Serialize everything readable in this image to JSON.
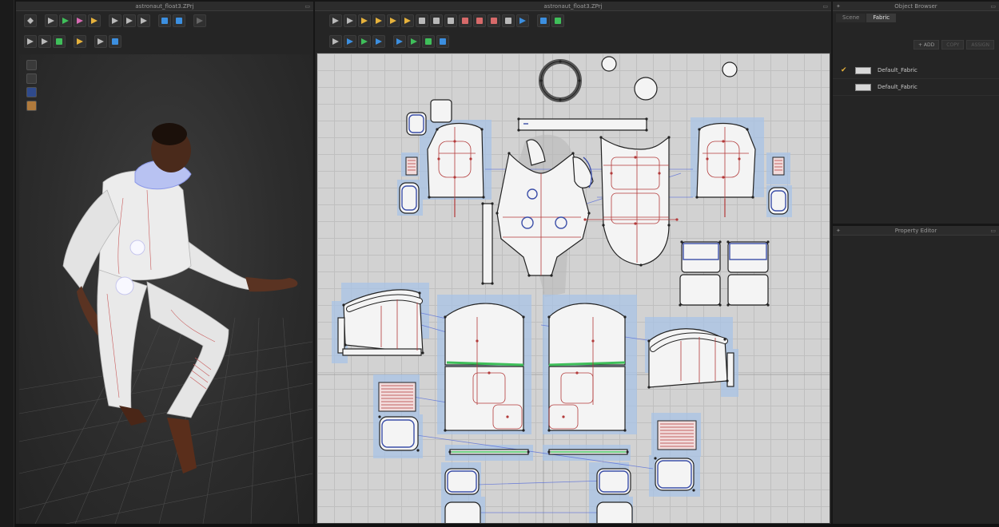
{
  "left_strip": {
    "label": ""
  },
  "viewport3d": {
    "title": "astronaut_float3.ZPrj"
  },
  "pattern2d": {
    "title": "astronaut_float3.ZPrj"
  },
  "object_browser": {
    "title": "Object Browser",
    "tabs": [
      "Scene",
      "Fabric"
    ],
    "active_tab": "Fabric",
    "actions": {
      "add": "+ ADD",
      "copy": "COPY",
      "assign": "ASSIGN"
    },
    "fabrics": [
      {
        "name": "Default_Fabric",
        "selected": true
      },
      {
        "name": "Default_Fabric",
        "selected": false
      }
    ]
  },
  "property_editor": {
    "title": "Property Editor"
  },
  "icons": {
    "dock": "dock-icon",
    "pin": "pin-icon",
    "check": "checkmark-icon"
  },
  "colors": {
    "seam_red": "#b23a3a",
    "seam_blue": "#5a6fd8",
    "seam_green": "#3fbf5a",
    "selection_blue": "#a9c4e6",
    "panel": "#252525",
    "check_gold": "#e6b23c"
  }
}
